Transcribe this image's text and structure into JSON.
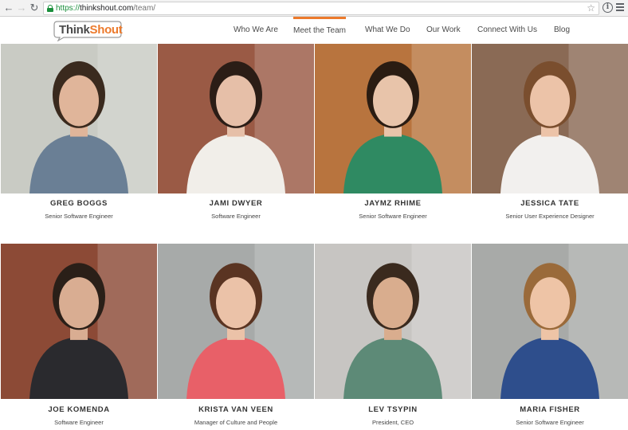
{
  "browser": {
    "url_protocol": "https://",
    "url_host": "thinkshout.com",
    "url_path": "/team/"
  },
  "site": {
    "logo_think": "Think",
    "logo_shout": "Shout",
    "brand_color": "#ec7a2c",
    "nav": [
      {
        "label": "Who We Are",
        "active": false
      },
      {
        "label": "Meet the Team",
        "active": true
      },
      {
        "label": "What We Do",
        "active": false
      },
      {
        "label": "Our Work",
        "active": false
      },
      {
        "label": "Connect With Us",
        "active": false
      },
      {
        "label": "Blog",
        "active": false
      }
    ]
  },
  "team": [
    {
      "name": "GREG BOGGS",
      "role": "Senior Software Engineer",
      "bg": "#c9cbc4",
      "shirt": "#6a7f95",
      "hair": "#3a2a1e",
      "skin": "#e0b59a"
    },
    {
      "name": "JAMI DWYER",
      "role": "Software Engineer",
      "bg": "#9a5a45",
      "shirt": "#f1eee9",
      "hair": "#2b1d16",
      "skin": "#e6bfa8"
    },
    {
      "name": "JAYMZ RHIME",
      "role": "Senior Software Engineer",
      "bg": "#b8743e",
      "shirt": "#2f8a62",
      "hair": "#2a1c12",
      "skin": "#e8c4aa"
    },
    {
      "name": "JESSICA TATE",
      "role": "Senior User Experience Designer",
      "bg": "#8a6a55",
      "shirt": "#f2f0ee",
      "hair": "#7a4e2e",
      "skin": "#ecc3a8"
    },
    {
      "name": "JOE KOMENDA",
      "role": "Software Engineer",
      "bg": "#8c4a36",
      "shirt": "#2a2a2e",
      "hair": "#2a1f18",
      "skin": "#d9ad92"
    },
    {
      "name": "KRISTA VAN VEEN",
      "role": "Manager of Culture and People",
      "bg": "#a7aaa9",
      "shirt": "#e86068",
      "hair": "#5a3422",
      "skin": "#ebc2a8"
    },
    {
      "name": "LEV TSYPIN",
      "role": "President, CEO",
      "bg": "#c7c5c2",
      "shirt": "#5d8a77",
      "hair": "#3a2a1e",
      "skin": "#d9ad8e"
    },
    {
      "name": "MARIA FISHER",
      "role": "Senior Software Engineer",
      "bg": "#a8aaa8",
      "shirt": "#2e4e8c",
      "hair": "#9a6a3a",
      "skin": "#eec4a6"
    }
  ]
}
